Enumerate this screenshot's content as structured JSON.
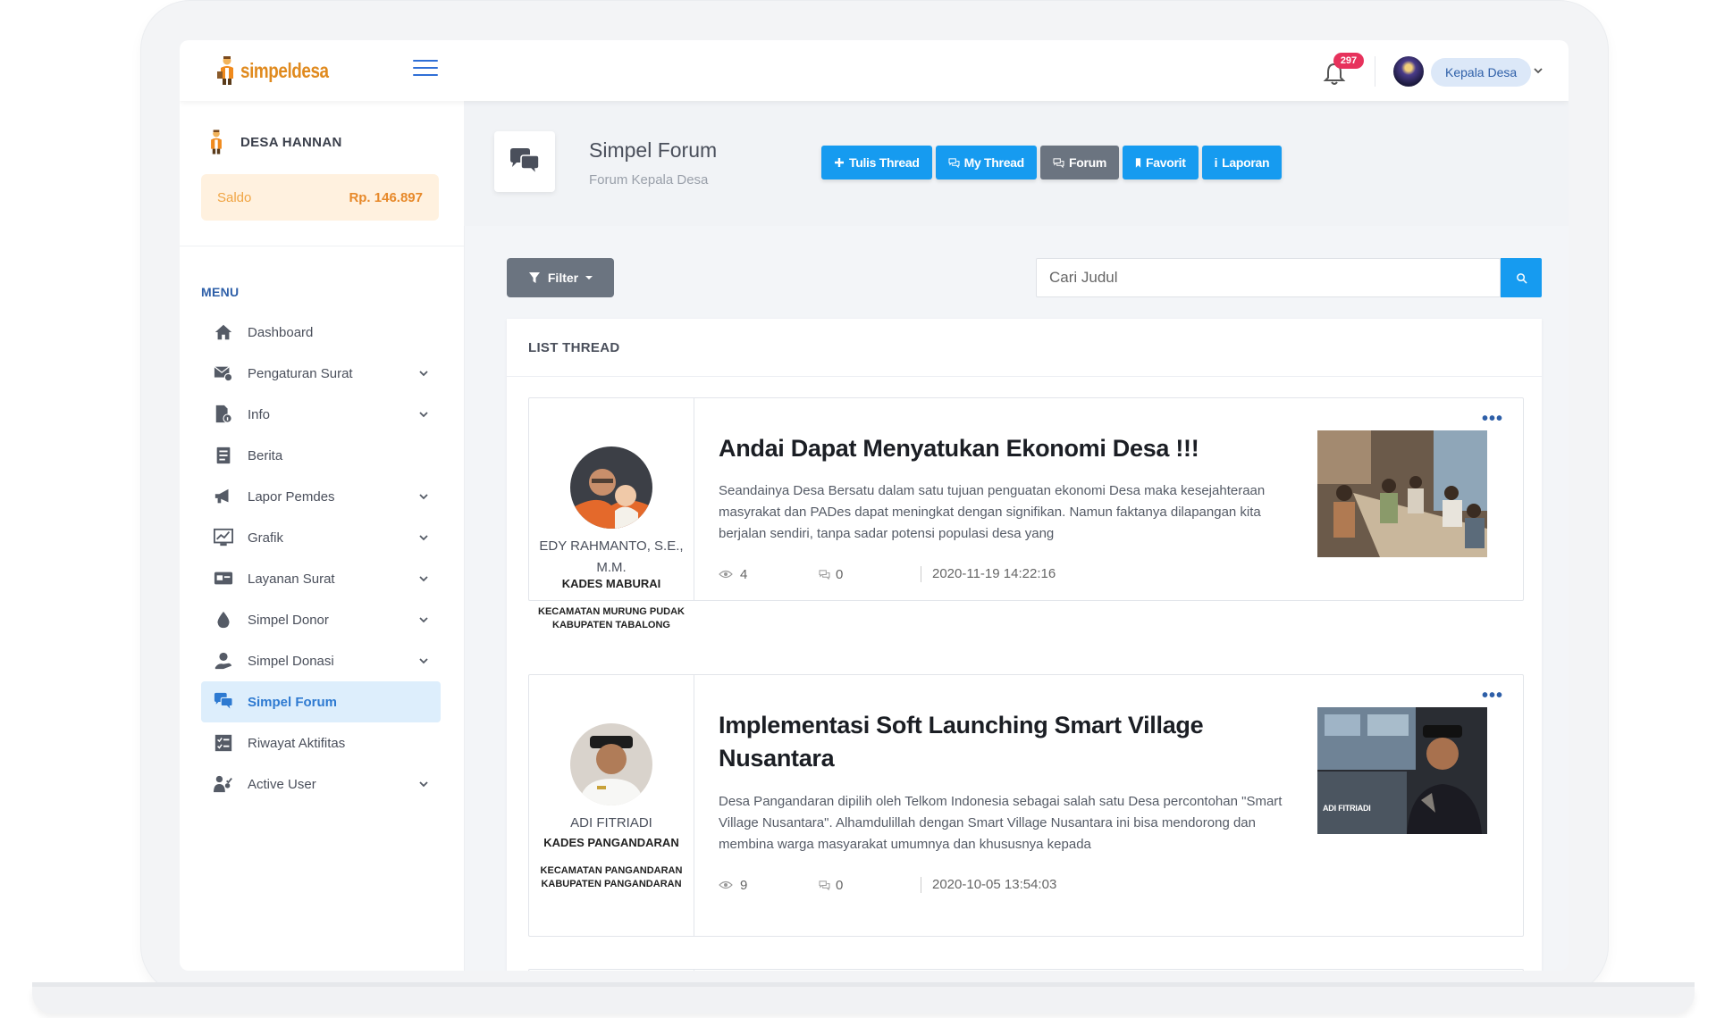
{
  "topbar": {
    "logo_text": "simpeldesa",
    "notification_count": "297",
    "user_label": "Kepala Desa"
  },
  "sidebar": {
    "desa_name": "DESA HANNAN",
    "saldo_label": "Saldo",
    "saldo_value": "Rp. 146.897",
    "menu_title": "MENU",
    "items": [
      {
        "label": "Dashboard",
        "icon": "home-icon",
        "chevron": false,
        "active": false
      },
      {
        "label": "Pengaturan Surat",
        "icon": "mail-settings-icon",
        "chevron": true,
        "active": false
      },
      {
        "label": "Info",
        "icon": "info-document-icon",
        "chevron": true,
        "active": false
      },
      {
        "label": "Berita",
        "icon": "news-icon",
        "chevron": false,
        "active": false
      },
      {
        "label": "Lapor Pemdes",
        "icon": "megaphone-icon",
        "chevron": true,
        "active": false
      },
      {
        "label": "Grafik",
        "icon": "chart-icon",
        "chevron": true,
        "active": false
      },
      {
        "label": "Layanan Surat",
        "icon": "letter-service-icon",
        "chevron": true,
        "active": false
      },
      {
        "label": "Simpel Donor",
        "icon": "blood-drop-icon",
        "chevron": true,
        "active": false
      },
      {
        "label": "Simpel Donasi",
        "icon": "donation-icon",
        "chevron": true,
        "active": false
      },
      {
        "label": "Simpel Forum",
        "icon": "chat-bubbles-icon",
        "chevron": false,
        "active": true
      },
      {
        "label": "Riwayat Aktifitas",
        "icon": "activity-list-icon",
        "chevron": false,
        "active": false
      },
      {
        "label": "Active User",
        "icon": "users-icon",
        "chevron": true,
        "active": false
      }
    ]
  },
  "forum": {
    "title": "Simpel Forum",
    "subtitle": "Forum Kepala Desa",
    "buttons": {
      "tulis_thread": "Tulis Thread",
      "my_thread": "My Thread",
      "forum": "Forum",
      "favorit": "Favorit",
      "laporan": "Laporan"
    },
    "filter_label": "Filter",
    "search_placeholder": "Cari Judul",
    "list_title": "LIST THREAD"
  },
  "threads": [
    {
      "author_name": "EDY RAHMANTO, S.E., M.M.",
      "author_role": "KADES MABURAI",
      "location_line1": "KECAMATAN MURUNG PUDAK",
      "location_line2": "KABUPATEN TABALONG",
      "title": "Andai Dapat Menyatukan Ekonomi Desa !!!",
      "excerpt": "Seandainya Desa Bersatu dalam satu tujuan penguatan ekonomi Desa maka kesejahteraan masyrakat dan PADes dapat meningkat dengan signifikan. Namun faktanya dilapangan kita berjalan sendiri, tanpa sadar potensi populasi desa yang",
      "views": "4",
      "comments": "0",
      "date": "2020-11-19 14:22:16"
    },
    {
      "author_name": "ADI FITRIADI",
      "author_role": "KADES PANGANDARAN",
      "location_line1": "KECAMATAN PANGANDARAN",
      "location_line2": "KABUPATEN PANGANDARAN",
      "title": "Implementasi Soft Launching Smart Village Nusantara",
      "excerpt": "Desa Pangandaran dipilih oleh Telkom Indonesia sebagai salah satu Desa percontohan \"Smart Village Nusantara\". Alhamdulillah dengan Smart Village Nusantara ini bisa mendorong dan membina warga masyarakat umumnya dan khususnya kepada",
      "views": "9",
      "comments": "0",
      "date": "2020-10-05 13:54:03",
      "thumb_caption": "ADI FITRIADI"
    }
  ],
  "colors": {
    "primary_blue": "#169bf0",
    "dark_button": "#6b7480",
    "menu_active_bg": "#ddeefc",
    "saldo_bg": "#fff1df",
    "accent_orange": "#e7892a",
    "badge_red": "#e7325c"
  }
}
